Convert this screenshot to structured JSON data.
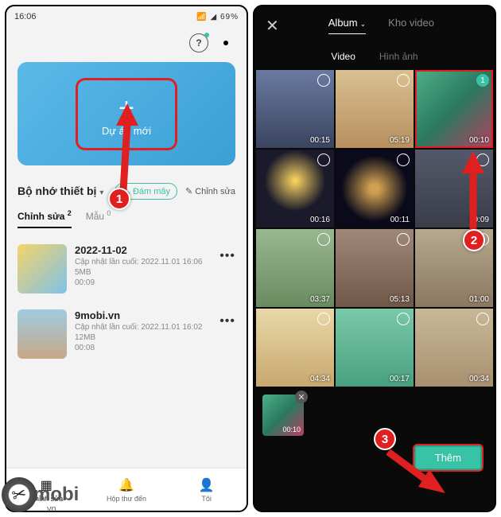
{
  "statusbar": {
    "time": "16:06",
    "battery": "69%"
  },
  "left": {
    "new_project": "Dự án mới",
    "storage_title": "Bộ nhớ thiết bị",
    "cloud_btn": "Đám mây",
    "edit_link": "Chỉnh sửa",
    "tabs": {
      "edit": "Chỉnh sửa",
      "edit_count": "2",
      "template": "Mẫu",
      "template_count": "0"
    },
    "projects": [
      {
        "name": "2022-11-02",
        "updated": "Cập nhật lần cuối: 2022.11.01 16:06",
        "size": "5MB",
        "dur": "00:09"
      },
      {
        "name": "9mobi.vn",
        "updated": "Cập nhật lần cuối: 2022.11.01 16:02",
        "size": "12MB",
        "dur": "00:08"
      }
    ],
    "nav": {
      "edit": "Chỉnh sửa",
      "inbox": "Hộp thư đến",
      "me": "Tôi"
    }
  },
  "right": {
    "tab_album": "Album",
    "tab_stock": "Kho video",
    "sub_video": "Video",
    "sub_image": "Hình ảnh",
    "cells": [
      {
        "dur": "00:15"
      },
      {
        "dur": "05:19"
      },
      {
        "dur": "00:10",
        "selected": true,
        "badge": "1"
      },
      {
        "dur": "00:16"
      },
      {
        "dur": "00:11"
      },
      {
        "dur": "00:09"
      },
      {
        "dur": "03:37"
      },
      {
        "dur": "05:13"
      },
      {
        "dur": "01:00"
      },
      {
        "dur": "04:34"
      },
      {
        "dur": "00:17"
      },
      {
        "dur": "00:34"
      }
    ],
    "selected_dur": "00:10",
    "add_btn": "Thêm"
  },
  "markers": {
    "m1": "1",
    "m2": "2",
    "m3": "3"
  },
  "logo": {
    "text": "mobi",
    "sub": ".vn"
  }
}
